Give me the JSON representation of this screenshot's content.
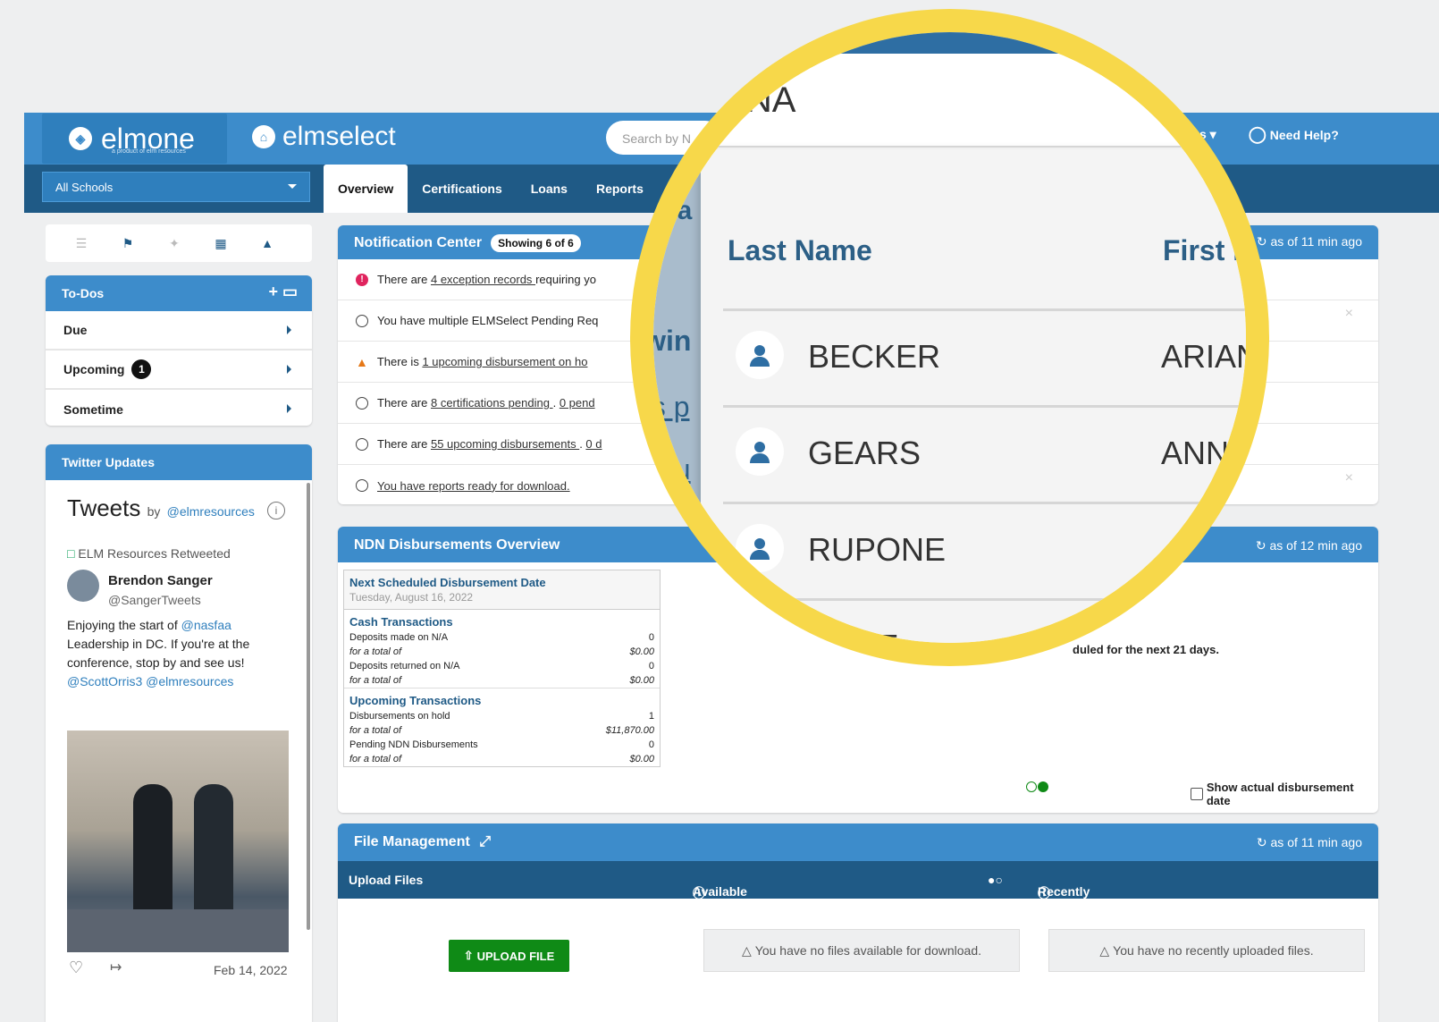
{
  "brand": {
    "elmone": "elmone",
    "elmone_tag": "a product of elm resources",
    "elmselect": "elmselect"
  },
  "search": {
    "placeholder": "Search by N"
  },
  "header_right": {
    "menu_fragment": "s",
    "help": "Need Help?"
  },
  "school_select": {
    "value": "All Schools"
  },
  "tabs": [
    {
      "label": "Overview"
    },
    {
      "label": "Certifications"
    },
    {
      "label": "Loans"
    },
    {
      "label": "Reports"
    }
  ],
  "todos": {
    "title": "To-Dos",
    "items": [
      {
        "label": "Due"
      },
      {
        "label": "Upcoming",
        "count": "1"
      },
      {
        "label": "Sometime"
      }
    ]
  },
  "twitter": {
    "title": "Twitter Updates",
    "tweets_label": "Tweets",
    "by": "by",
    "handle": "@elmresources",
    "retweeted": "ELM Resources Retweeted",
    "author": "Brendon Sanger",
    "author_handle": "@SangerTweets",
    "text_1": "Enjoying the start of ",
    "mention_1": "@nasfaa",
    "text_2": "Leadership in DC. If you're at the conference, stop by and see us!",
    "mention_2": "@ScottOrris3",
    "mention_3": "@elmresources",
    "date": "Feb 14, 2022"
  },
  "notifications": {
    "title": "Notification Center",
    "showing": "Showing 6 of 6",
    "as_of": "as of 11 min ago",
    "items": [
      {
        "pre": "There are ",
        "link": "4 exception records ",
        "post": "requiring yo"
      },
      {
        "pre": "You have multiple ELMSelect Pending Req",
        "link": "",
        "post": ""
      },
      {
        "pre": "There is ",
        "link": "1 upcoming disbursement on ho",
        "post": ""
      },
      {
        "pre": "There are ",
        "link": "8 certifications pending ",
        "post": ". ",
        "link2": "0 pend"
      },
      {
        "pre": "There are ",
        "link": "55 upcoming disbursements ",
        "post": ". ",
        "link2": "0 d"
      },
      {
        "pre": "",
        "link": "You have reports ready for download.",
        "post": ""
      }
    ]
  },
  "ndn": {
    "title": "NDN Disbursements Overview",
    "as_of": "as of 12 min ago",
    "next_label": "Next Scheduled Disbursement Date",
    "next_date": "Tuesday, August 16, 2022",
    "cash_title": "Cash Transactions",
    "rows_cash": [
      {
        "label": "Deposits made on N/A",
        "value": "0"
      },
      {
        "label": "for a total of",
        "value": "$0.00"
      },
      {
        "label": "Deposits returned on N/A",
        "value": "0"
      },
      {
        "label": "for a total of",
        "value": "$0.00"
      }
    ],
    "upcoming_title": "Upcoming Transactions",
    "rows_upcoming": [
      {
        "label": "Disbursements on hold",
        "value": "1"
      },
      {
        "label": "for a total of",
        "value": "$11,870.00"
      },
      {
        "label": "Pending NDN Disbursements",
        "value": "0"
      },
      {
        "label": "for a total of",
        "value": "$0.00"
      }
    ],
    "scheduled_msg": "duled for the next 21 days.",
    "show_actual": "Show actual disbursement date"
  },
  "files": {
    "title": "File Management",
    "as_of": "as of 11 min ago",
    "upload_col": "Upload Files",
    "available_col": "Available for Download",
    "recent_col": "Recently Uploaded",
    "upload_btn": "UPLOAD FILE",
    "no_available": "You have no files available for download.",
    "no_recent": "You have no recently uploaded files."
  },
  "magnifier": {
    "search_value": "NNA",
    "bg_fragments": [
      "Loa",
      "howin",
      "ns p",
      "sbu"
    ],
    "col_last": "Last Name",
    "col_first": "First N",
    "rows": [
      {
        "last": "BECKER",
        "first": "ARIAN"
      },
      {
        "last": "GEARS",
        "first": "ANNA"
      },
      {
        "last": "RUPONE",
        "first": ""
      },
      {
        "last": "COST",
        "first": ""
      }
    ]
  },
  "colors": {
    "brand_blue": "#3d8ccb",
    "navy": "#1f5a86",
    "highlight": "#f7d84a",
    "success": "#0f8a16"
  }
}
